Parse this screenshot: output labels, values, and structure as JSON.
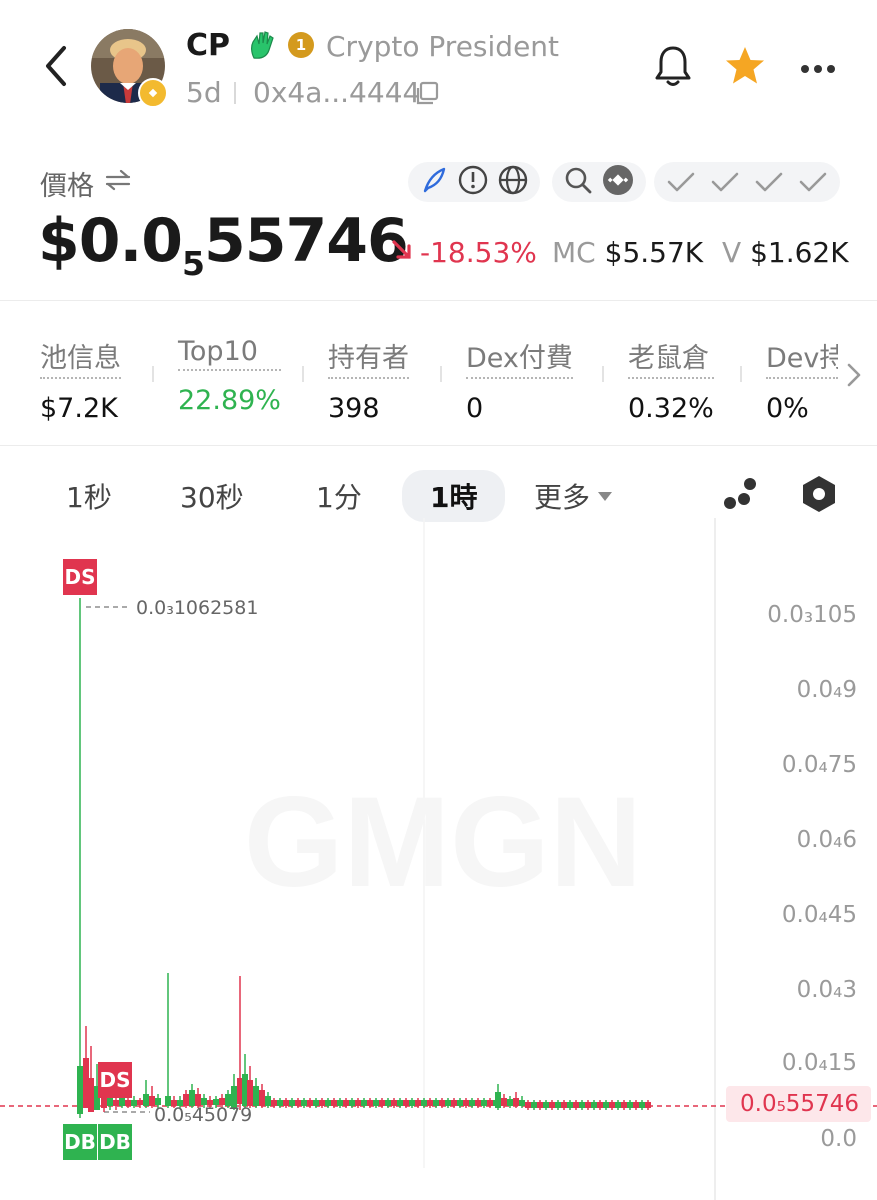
{
  "header": {
    "back_icon": "chevron-left-icon",
    "avatar_badge_icon": "bnb-badge-icon",
    "symbol": "CP",
    "rank_badge": "1",
    "token_name": "Crypto President",
    "age": "5d",
    "address": "0x4a...4444",
    "copy_icon": "copy-icon",
    "actions": [
      "bell-icon",
      "star-icon",
      "more-icon"
    ]
  },
  "price_section": {
    "label": "價格",
    "swap_icon": "swap-icon",
    "price_prefix": "$0.0",
    "price_sub": "5",
    "price_suffix": "55746",
    "change": "-18.53%",
    "mc_label": "MC",
    "mc_value": "$5.57K",
    "vol_label": "V",
    "vol_value": "$1.62K",
    "colors": {
      "down": "#e0354f",
      "up": "#2fb350",
      "star": "#f5a623"
    }
  },
  "stats": [
    {
      "label": "池信息",
      "value": "$7.2K"
    },
    {
      "label": "Top10",
      "value": "22.89%"
    },
    {
      "label": "持有者",
      "value": "398"
    },
    {
      "label": "Dex付費",
      "value": "0"
    },
    {
      "label": "老鼠倉",
      "value": "0.32%"
    },
    {
      "label": "Dev持",
      "value": "0%"
    }
  ],
  "timeframes": {
    "items": [
      "1秒",
      "30秒",
      "1分",
      "1時"
    ],
    "active": "1時",
    "more": "更多"
  },
  "chart": {
    "watermark": "GMGN",
    "high_label": "0.0₃1062581",
    "low_label": "0.0₅45079",
    "current_price_label": "0.0₅55746",
    "y_ticks": [
      "0.0₃105",
      "0.0₄9",
      "0.0₄75",
      "0.0₄6",
      "0.0₄45",
      "0.0₄3",
      "0.0₄15",
      "0.0"
    ],
    "markers": {
      "sell": "DS",
      "buy": "DB"
    }
  },
  "chart_data": {
    "type": "candlestick",
    "title": "",
    "xlabel": "",
    "ylabel": "",
    "y_unit": "USD",
    "ylim": [
      0,
      0.000105
    ],
    "high": 0.0001062581,
    "low": 4.5079e-06,
    "current": 5.5746e-06,
    "y_ticks": [
      0.000105,
      9e-05,
      7.5e-05,
      6e-05,
      4.5e-05,
      3e-05,
      1.5e-05,
      0
    ],
    "trades": [
      {
        "type": "DS",
        "price": 0.0001062581
      },
      {
        "type": "DS",
        "price": 6.5e-06
      },
      {
        "type": "DB",
        "price": 4.5079e-06
      },
      {
        "type": "DB",
        "price": 4.5079e-06
      }
    ]
  }
}
